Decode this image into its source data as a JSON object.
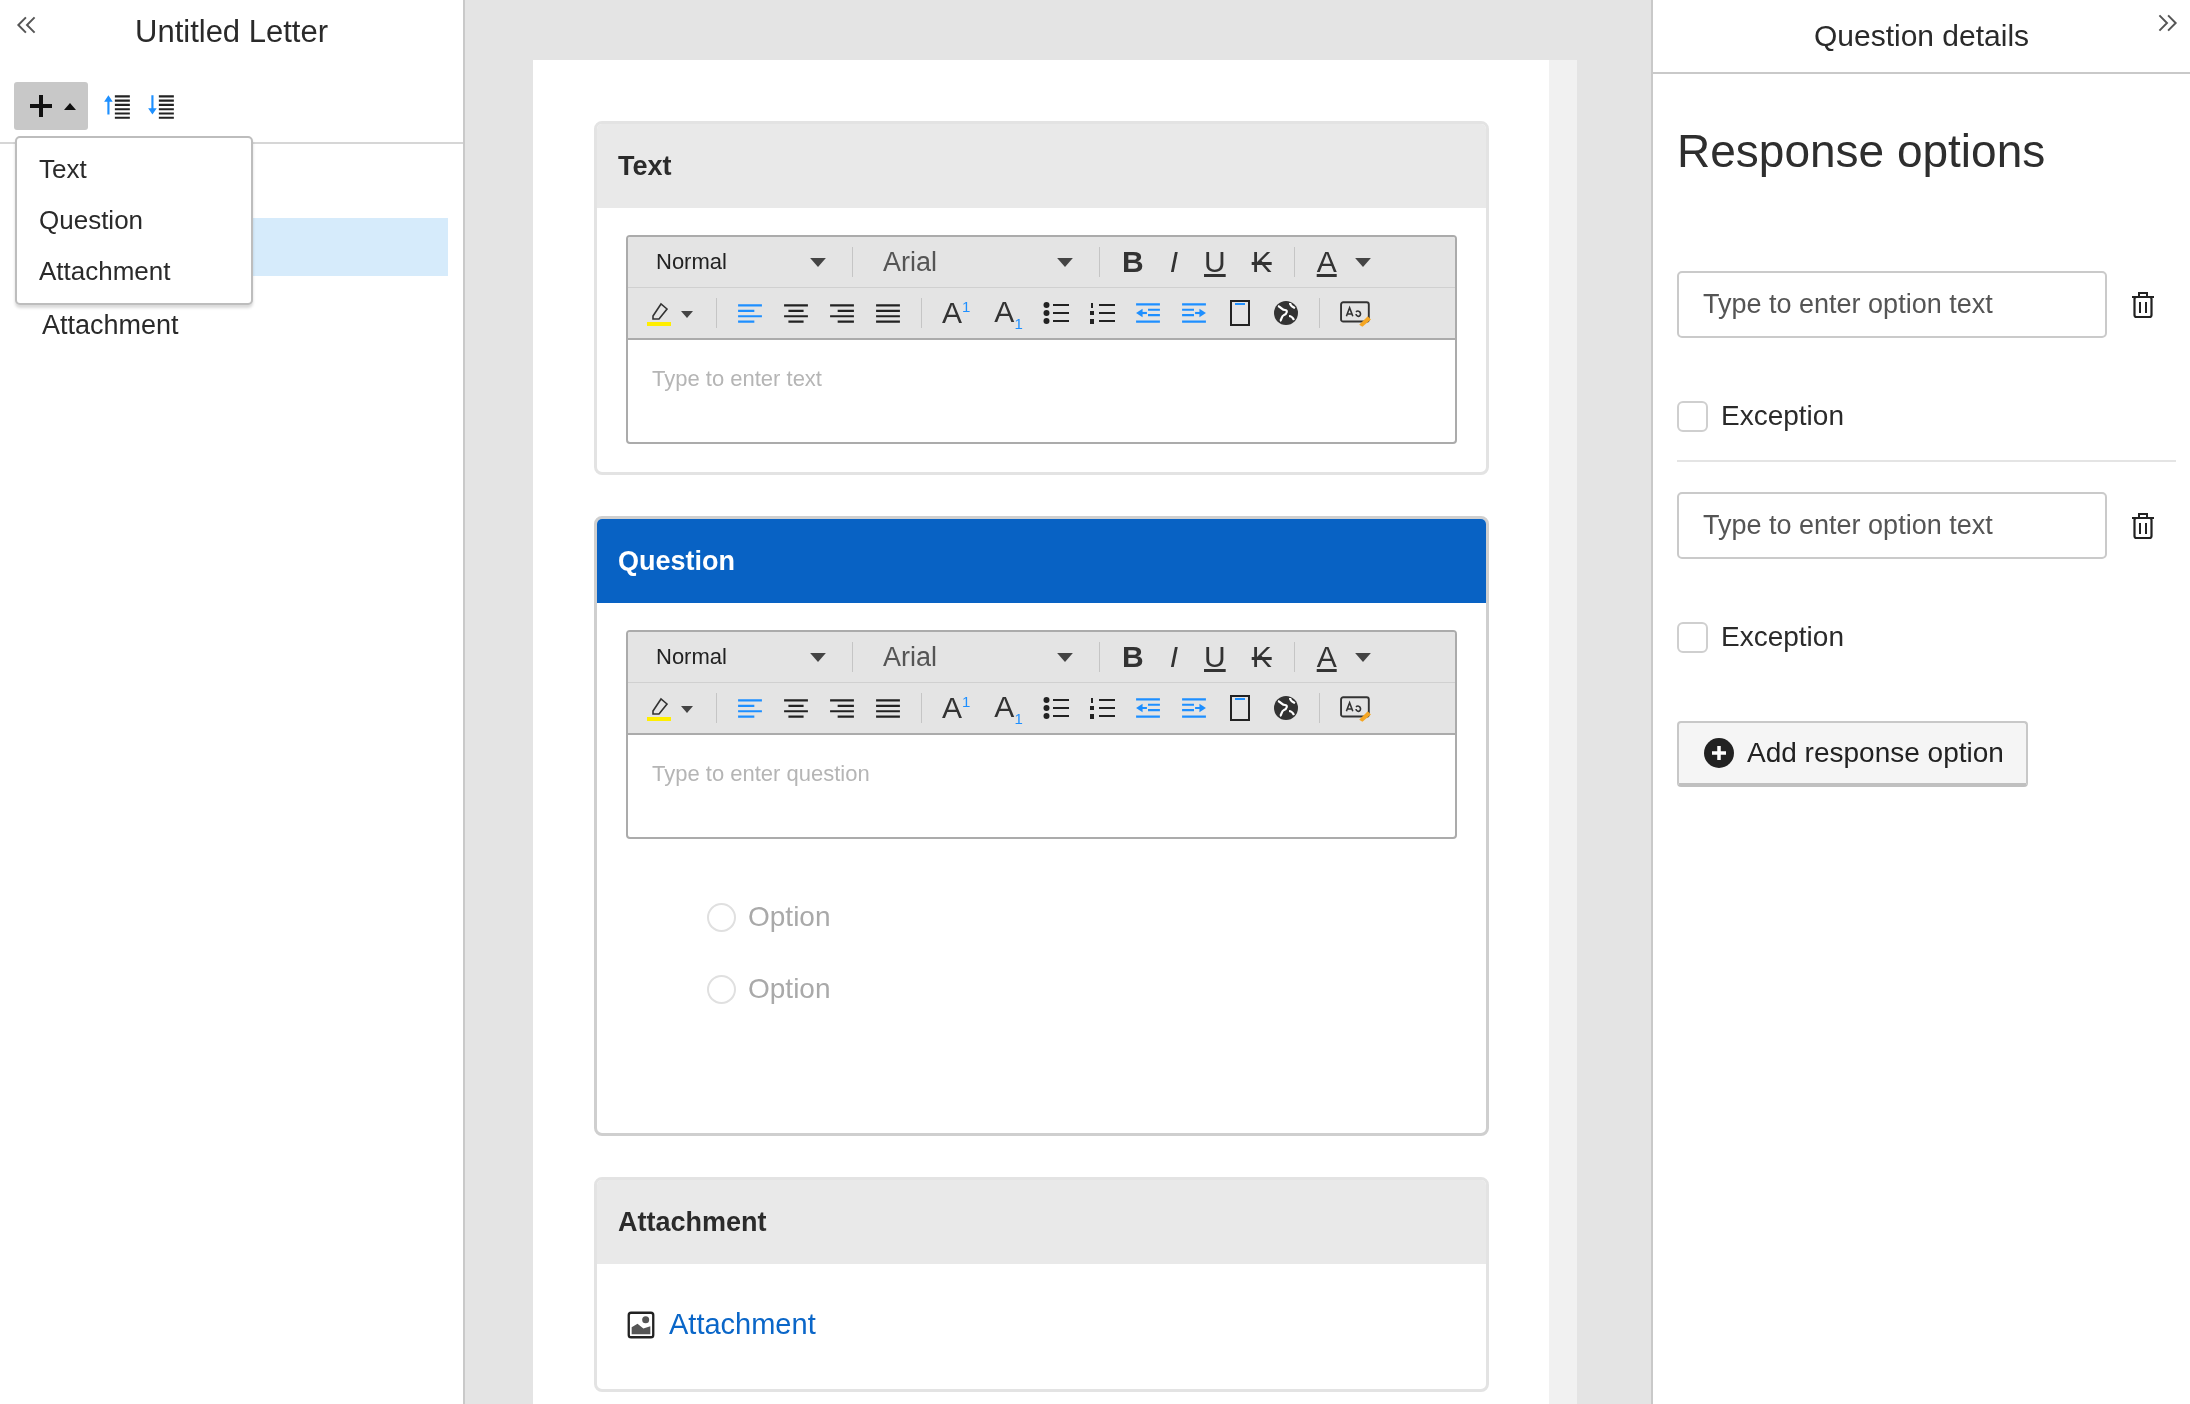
{
  "left_panel": {
    "title": "Untitled Letter",
    "add_menu": {
      "expanded": true,
      "items": [
        {
          "label": "Text"
        },
        {
          "label": "Question"
        },
        {
          "label": "Attachment"
        }
      ]
    },
    "outline": [
      {
        "selected": true
      },
      {
        "label": "Attachment",
        "selected": false
      }
    ]
  },
  "document": {
    "blocks": [
      {
        "kind": "text",
        "title": "Text",
        "selected": false,
        "editor": {
          "style": "Normal",
          "font": "Arial",
          "placeholder": "Type to enter text",
          "toolbar": [
            {
              "kind": "bold",
              "glyph": "B"
            },
            {
              "kind": "italic",
              "glyph": "I"
            },
            {
              "kind": "underline",
              "glyph": "U"
            },
            {
              "kind": "clear",
              "glyph": "K"
            },
            {
              "kind": "color",
              "glyph": "A"
            }
          ],
          "align": [
            {
              "kind": "left",
              "selected": true
            },
            {
              "kind": "center",
              "selected": false
            },
            {
              "kind": "right",
              "selected": false
            },
            {
              "kind": "justify",
              "selected": false
            }
          ],
          "script": [
            {
              "kind": "sup",
              "glyph": "A$^{1}$"
            },
            {
              "kind": "sub",
              "glyph": "A$_{1}$"
            }
          ]
        }
      },
      {
        "kind": "question",
        "title": "Question",
        "selected": true,
        "editor": {
          "style": "Normal",
          "font": "Arial",
          "placeholder": "Type to enter question",
          "toolbar": [
            {
              "kind": "bold",
              "glyph": "B"
            },
            {
              "kind": "italic",
              "glyph": "I"
            },
            {
              "kind": "underline",
              "glyph": "U"
            },
            {
              "kind": "clear",
              "glyph": "K"
            },
            {
              "kind": "color",
              "glyph": "A"
            }
          ],
          "align": [
            {
              "kind": "left",
              "selected": true
            },
            {
              "kind": "center",
              "selected": false
            },
            {
              "kind": "right",
              "selected": false
            },
            {
              "kind": "justify",
              "selected": false
            }
          ],
          "script": [
            {
              "kind": "sup",
              "glyph": "A$^{1}$"
            },
            {
              "kind": "sub",
              "glyph": "A$_{1}$"
            }
          ]
        },
        "options": [
          {
            "label": "Option",
            "selected": false
          },
          {
            "label": "Option",
            "selected": false
          }
        ]
      },
      {
        "kind": "attachment",
        "title": "Attachment",
        "selected": false,
        "link": "Attachment"
      }
    ]
  },
  "right_panel": {
    "title": "Question details",
    "heading": "Response options",
    "options": [
      {
        "placeholder": "Type to enter option text",
        "exception_label": "Exception",
        "checked": false
      },
      {
        "placeholder": "Type to enter option text",
        "exception_label": "Exception",
        "checked": false
      }
    ],
    "add_button": "Add response option"
  }
}
